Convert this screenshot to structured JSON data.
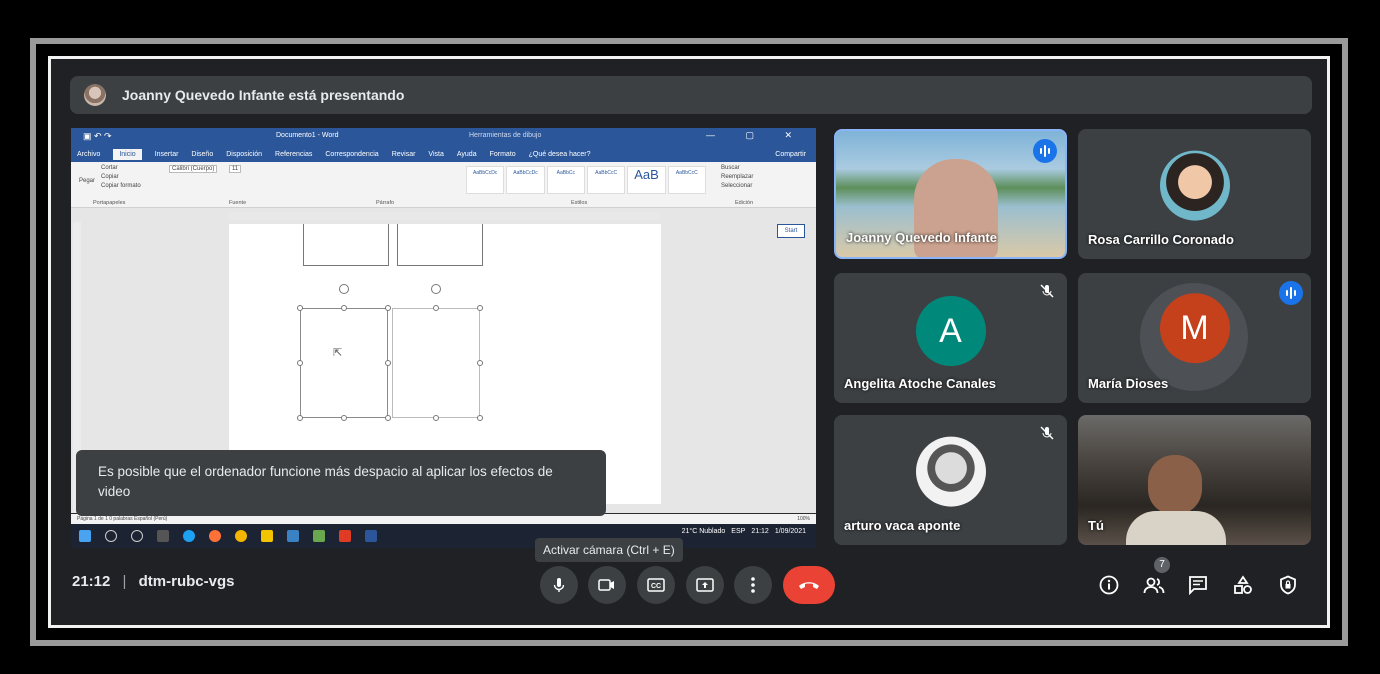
{
  "presenter_banner": "Joanny Quevedo Infante está presentando",
  "shared_screen": {
    "word_title": "Documento1 - Word",
    "word_context_title": "Herramientas de dibujo",
    "tabs": [
      "Archivo",
      "Inicio",
      "Insertar",
      "Diseño",
      "Disposición",
      "Referencias",
      "Correspondencia",
      "Revisar",
      "Vista",
      "Ayuda",
      "Formato",
      "¿Qué desea hacer?"
    ],
    "share_label": "Compartir",
    "font_name": "Calibri (Cuerpo)",
    "font_size": "11",
    "groups": [
      "Portapapeles",
      "Fuente",
      "Párrafo",
      "Estilos",
      "Edición"
    ],
    "clipboard": [
      "Cortar",
      "Copiar",
      "Copiar formato",
      "Pegar"
    ],
    "styles": [
      "AaBbCcDc",
      "AaBbCcDc",
      "AaBbCc",
      "AaBbCcC",
      "AaB",
      "AaBbCcC"
    ],
    "edit": [
      "Buscar",
      "Reemplazar",
      "Seleccionar"
    ],
    "side_box": "Start",
    "status": "Página 1 de 1   0 palabras   Español (Perú)",
    "zoom": "100%",
    "tray_weather": "21°C  Nublado",
    "tray_lang": "ESP",
    "tray_time": "21:12",
    "tray_date": "1/09/2021"
  },
  "toast": "Es posible que el ordenador funcione más despacio al aplicar los efectos de video",
  "tooltip": "Activar cámara (Ctrl + E)",
  "participants": [
    {
      "name": "Joanny Quevedo Infante"
    },
    {
      "name": "Rosa Carrillo Coronado"
    },
    {
      "name": "Angelita Atoche Canales",
      "initial": "A"
    },
    {
      "name": "María Dioses",
      "initial": "M"
    },
    {
      "name": "arturo vaca aponte"
    },
    {
      "name": "Tú"
    }
  ],
  "meeting": {
    "time": "21:12",
    "code": "dtm-rubc-vgs",
    "participant_count": "7"
  },
  "colors": {
    "accent": "#1a73e8",
    "end_call": "#ea4335",
    "avatar_a": "#00897b",
    "avatar_m": "#c5411c"
  }
}
